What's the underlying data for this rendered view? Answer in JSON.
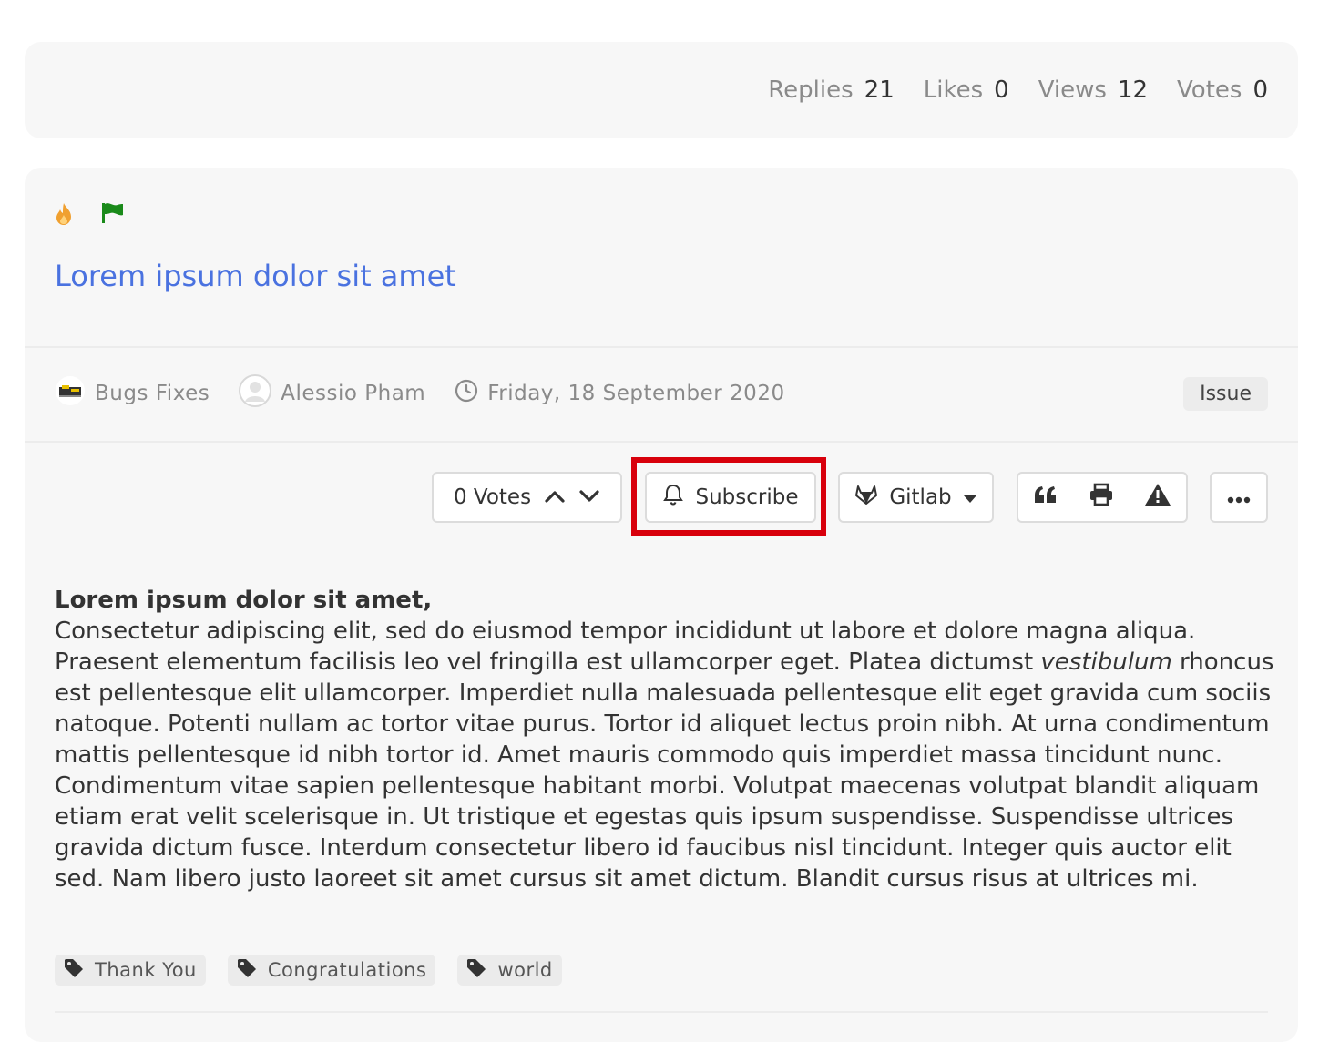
{
  "stats": [
    {
      "label": "Replies",
      "value": "21"
    },
    {
      "label": "Likes",
      "value": "0"
    },
    {
      "label": "Views",
      "value": "12"
    },
    {
      "label": "Votes",
      "value": "0"
    }
  ],
  "post": {
    "title": "Lorem ipsum dolor sit amet",
    "category": "Bugs Fixes",
    "author": "Alessio Pham",
    "date": "Friday, 18 September 2020",
    "badge": "Issue",
    "body_heading": "Lorem ipsum dolor sit amet,",
    "body_text_1": "Consectetur adipiscing elit, sed do eiusmod tempor incididunt ut labore et dolore magna aliqua. Praesent elementum facilisis leo vel fringilla est ullamcorper eget. Platea dictumst ",
    "body_italic": "vestibulum",
    "body_text_2": " rhoncus est pellentesque elit ullamcorper. Imperdiet nulla malesuada pellentesque elit eget gravida cum sociis natoque. Potenti nullam ac tortor vitae purus. Tortor id aliquet lectus proin nibh. At urna condimentum mattis pellentesque id nibh tortor id. Amet mauris commodo quis imperdiet massa tincidunt nunc. Condimentum vitae sapien pellentesque habitant morbi. Volutpat maecenas volutpat blandit aliquam etiam erat velit scelerisque in. Ut tristique et egestas quis ipsum suspendisse. Suspendisse ultrices gravida dictum fusce. Interdum consectetur libero id faucibus nisl tincidunt. Integer quis auctor elit sed. Nam libero justo laoreet sit amet cursus sit amet dictum. Blandit cursus risus at ultrices mi."
  },
  "toolbar": {
    "votes_label": "0 Votes",
    "subscribe_label": "Subscribe",
    "gitlab_label": "Gitlab"
  },
  "tags": [
    "Thank You",
    "Congratulations",
    "world"
  ],
  "colors": {
    "title": "#4a72e0",
    "highlight": "#d8000c",
    "fire": "#f0a030",
    "flag": "#1a8a1a"
  }
}
